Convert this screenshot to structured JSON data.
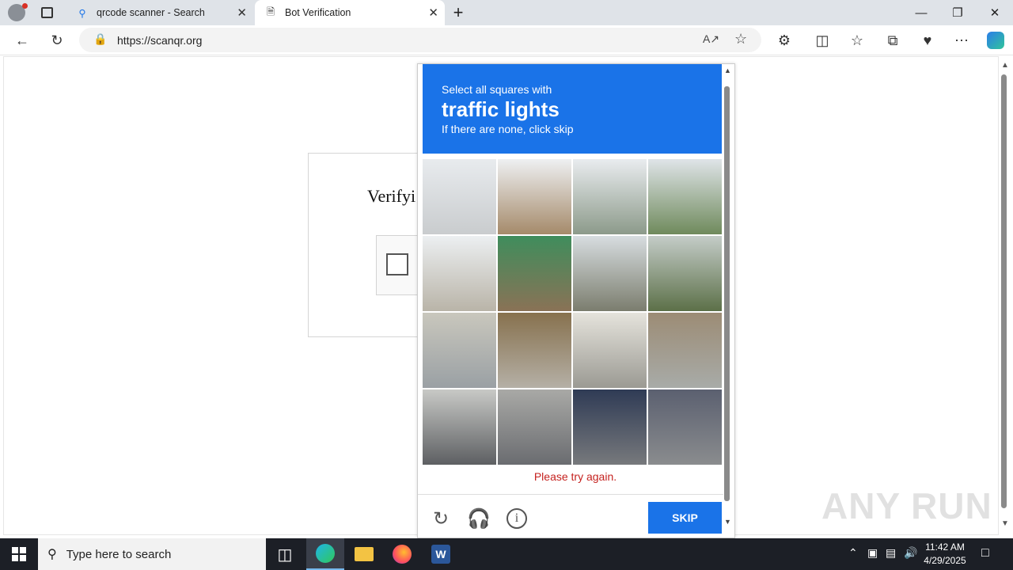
{
  "browser": {
    "tabs": [
      {
        "title": "qrcode scanner - Search",
        "icon": "search-icon"
      },
      {
        "title": "Bot Verification",
        "icon": "page-icon",
        "active": true
      }
    ],
    "url": "https://scanqr.org"
  },
  "page": {
    "verify_title": "Verifyi",
    "captcha": {
      "instruction": "Select all squares with",
      "target": "traffic lights",
      "hint": "If there are none, click skip",
      "error": "Please try again.",
      "skip_label": "SKIP",
      "grid_rows": 4,
      "grid_cols": 4,
      "image_description_icon": "street-intersection-photo",
      "header_color": "#1a73e8"
    }
  },
  "watermark": "ANY RUN",
  "taskbar": {
    "search_placeholder": "Type here to search",
    "time": "11:42 AM",
    "date": "4/29/2025"
  }
}
